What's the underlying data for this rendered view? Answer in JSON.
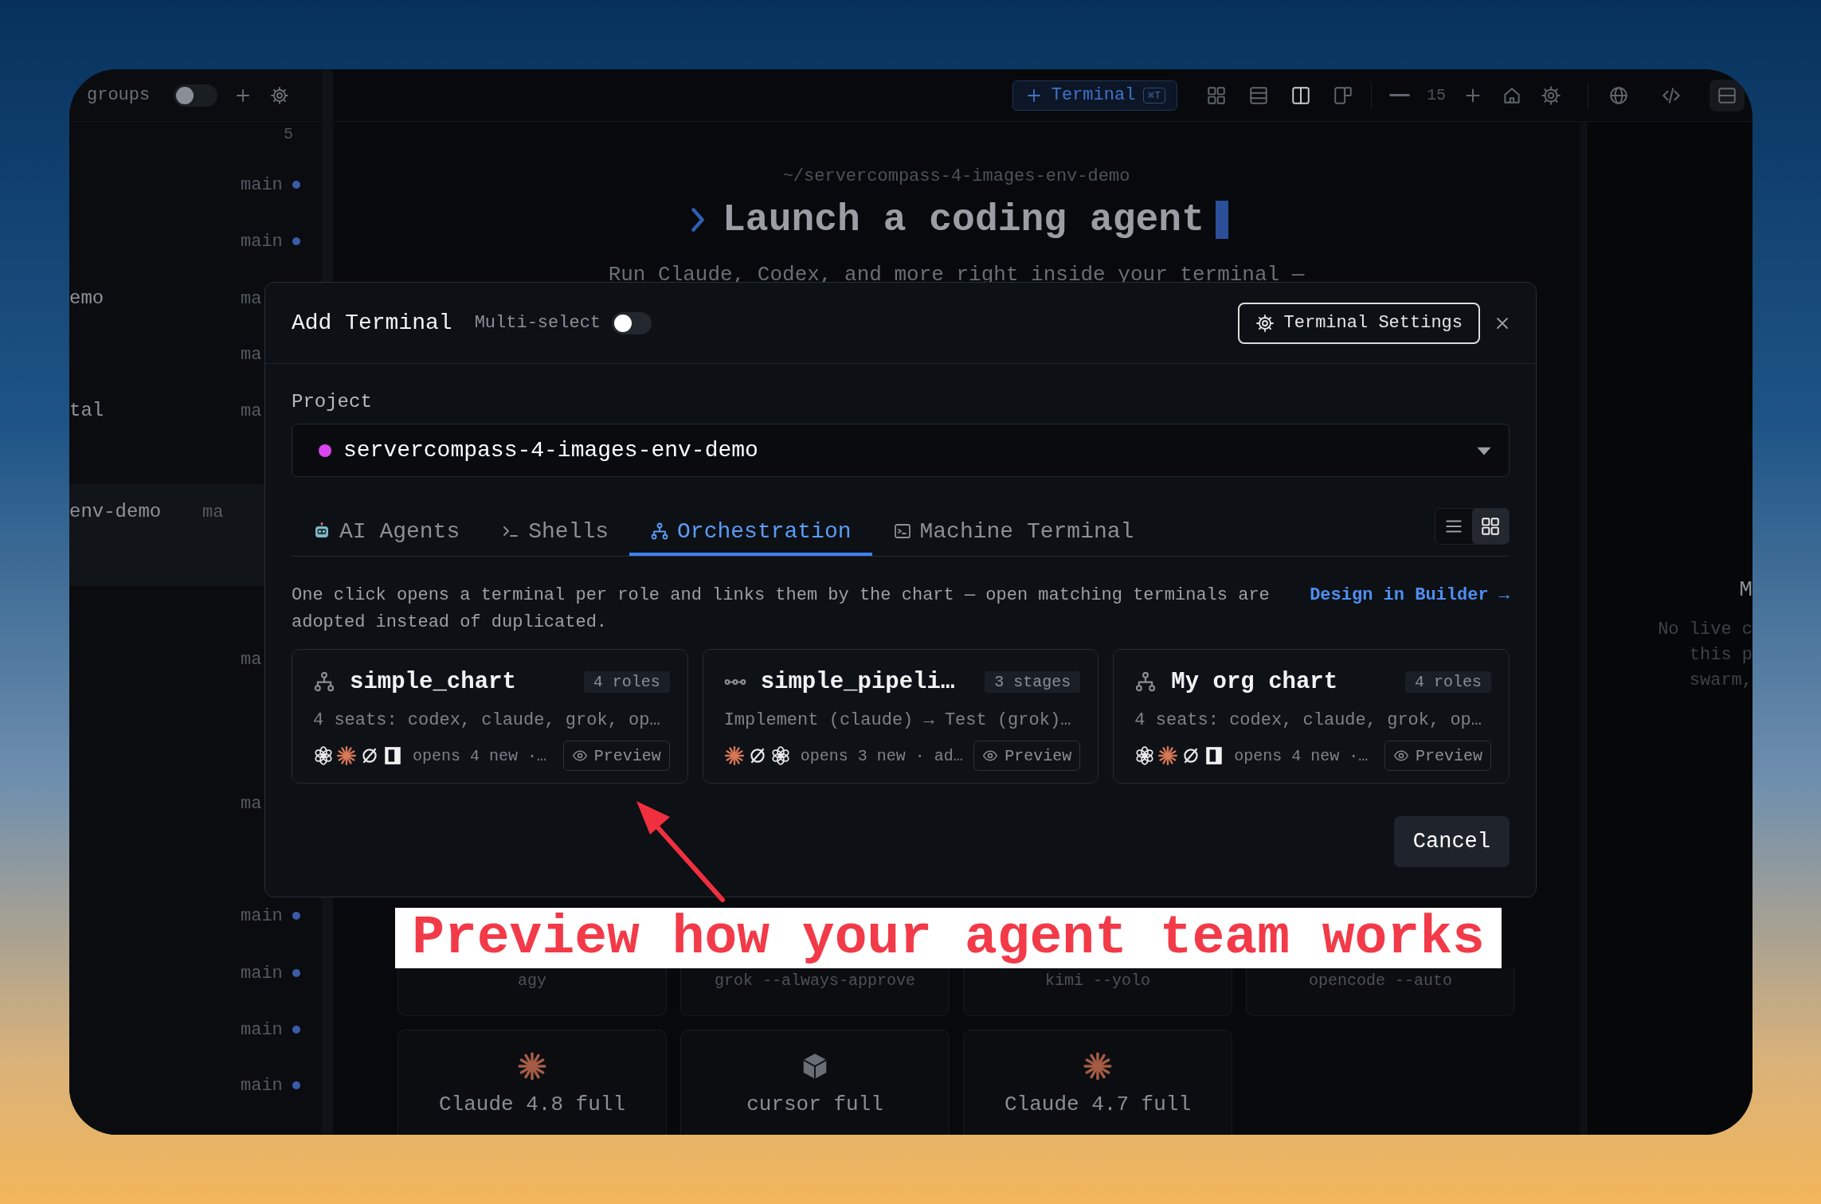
{
  "sidebar": {
    "title": "groups",
    "toggle_on": false,
    "count": "5",
    "items": [
      {
        "branch": "main",
        "dot": true,
        "selected": false
      },
      {
        "branch": "main",
        "dot": true,
        "selected": false
      },
      {
        "name": "emo",
        "branch": "ma",
        "dot": false,
        "selected": false
      },
      {
        "branch": "ma",
        "dot": false,
        "selected": false
      },
      {
        "name": "tal",
        "branch": "ma",
        "dot": false,
        "selected": false
      },
      {
        "name": "env-demo",
        "branch": "ma",
        "dot": false,
        "selected": true
      },
      {
        "branch": "ma",
        "dot": false,
        "selected": false
      },
      {
        "branch": "ma",
        "dot": false,
        "selected": false
      },
      {
        "branch": "main",
        "dot": true,
        "selected": false
      },
      {
        "branch": "main",
        "dot": true,
        "selected": false
      },
      {
        "branch": "main",
        "dot": true,
        "selected": false
      },
      {
        "branch": "main",
        "dot": true,
        "selected": false
      }
    ]
  },
  "toolbar": {
    "new_terminal": {
      "label": "Terminal",
      "shortcut": "⌘T"
    },
    "layouts": [
      {
        "kind": "grid",
        "selected": false
      },
      {
        "kind": "rows",
        "selected": false
      },
      {
        "kind": "columns",
        "selected": true
      },
      {
        "kind": "split",
        "selected": false
      }
    ],
    "font_size": "15"
  },
  "main": {
    "path": "~/servercompass-4-images-env-demo",
    "title": "Launch a coding agent",
    "subtitle": "Run Claude, Codex, and more right inside your terminal —",
    "agents": [
      {
        "kind": "plain",
        "label": "agy"
      },
      {
        "kind": "plain",
        "label": "grok --always-approve"
      },
      {
        "kind": "plain",
        "label": "kimi --yolo"
      },
      {
        "kind": "plain",
        "label": "opencode --auto"
      },
      {
        "kind": "claude",
        "label": "Claude 4.8 full"
      },
      {
        "kind": "cube",
        "label": "cursor full"
      },
      {
        "kind": "claude",
        "label": "Claude 4.7 full"
      }
    ]
  },
  "right_panel": {
    "heading": "M",
    "lines": [
      "No live c",
      "this p",
      "swarm,"
    ]
  },
  "dialog": {
    "title": "Add Terminal",
    "multi_select": {
      "label": "Multi-select",
      "on": false
    },
    "settings_button": "Terminal Settings",
    "project": {
      "label": "Project",
      "value": "servercompass-4-images-env-demo"
    },
    "tabs": [
      {
        "kind": "agents",
        "label": "AI Agents",
        "selected": false
      },
      {
        "kind": "shells",
        "label": "Shells",
        "selected": false
      },
      {
        "kind": "orchestration",
        "label": "Orchestration",
        "selected": true
      },
      {
        "kind": "machine",
        "label": "Machine Terminal",
        "selected": false
      }
    ],
    "views": [
      {
        "kind": "list",
        "selected": false
      },
      {
        "kind": "grid",
        "selected": true
      }
    ],
    "description": "One click opens a terminal per role and links them by the chart — open matching terminals are adopted instead of duplicated.",
    "builder_link": "Design in Builder →",
    "cards": [
      {
        "kind": "chart",
        "title": "simple_chart",
        "badge": "4 roles",
        "summary": "4 seats: codex, claude, grok, op…",
        "agent_icons": [
          {
            "kind": "openai"
          },
          {
            "kind": "claude"
          },
          {
            "kind": "grok"
          },
          {
            "kind": "square"
          }
        ],
        "detail": "opens 4 new ·…",
        "preview": "Preview"
      },
      {
        "kind": "pipeline",
        "title": "simple_pipeli…",
        "badge": "3 stages",
        "summary": "Implement (claude) → Test (grok)…",
        "agent_icons": [
          {
            "kind": "claude"
          },
          {
            "kind": "grok"
          },
          {
            "kind": "openai"
          }
        ],
        "detail": "opens 3 new · ad…",
        "preview": "Preview"
      },
      {
        "kind": "chart",
        "title": "My org chart",
        "badge": "4 roles",
        "summary": "4 seats: codex, claude, grok, op…",
        "agent_icons": [
          {
            "kind": "openai"
          },
          {
            "kind": "claude"
          },
          {
            "kind": "grok"
          },
          {
            "kind": "square"
          }
        ],
        "detail": "opens 4 new ·…",
        "preview": "Preview"
      }
    ],
    "cancel": "Cancel"
  },
  "annotation": {
    "caption": "Preview how your agent team works"
  }
}
